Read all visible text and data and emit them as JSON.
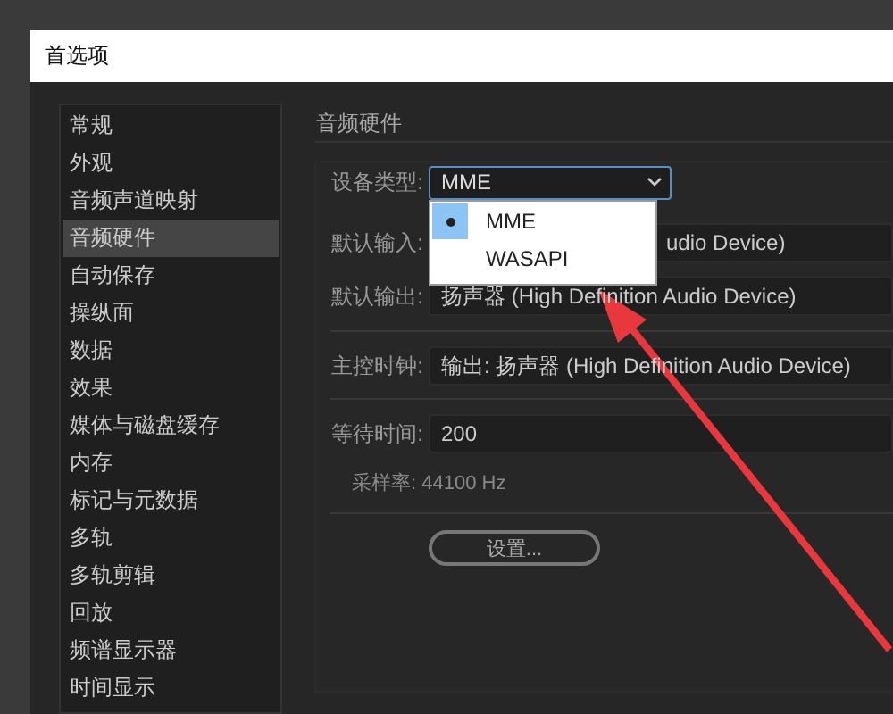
{
  "window": {
    "title": "首选项"
  },
  "sidebar": {
    "items": [
      {
        "label": "常规",
        "selected": false
      },
      {
        "label": "外观",
        "selected": false
      },
      {
        "label": "音频声道映射",
        "selected": false
      },
      {
        "label": "音频硬件",
        "selected": true
      },
      {
        "label": "自动保存",
        "selected": false
      },
      {
        "label": "操纵面",
        "selected": false
      },
      {
        "label": "数据",
        "selected": false
      },
      {
        "label": "效果",
        "selected": false
      },
      {
        "label": "媒体与磁盘缓存",
        "selected": false
      },
      {
        "label": "内存",
        "selected": false
      },
      {
        "label": "标记与元数据",
        "selected": false
      },
      {
        "label": "多轨",
        "selected": false
      },
      {
        "label": "多轨剪辑",
        "selected": false
      },
      {
        "label": "回放",
        "selected": false
      },
      {
        "label": "频谱显示器",
        "selected": false
      },
      {
        "label": "时间显示",
        "selected": false
      }
    ]
  },
  "section": {
    "title": "音频硬件",
    "device_type": {
      "label": "设备类型:",
      "value": "MME",
      "expanded": true,
      "options": [
        {
          "label": "MME",
          "selected": true
        },
        {
          "label": "WASAPI",
          "selected": false
        }
      ]
    },
    "default_input": {
      "label": "默认输入:",
      "value": "udio Device)"
    },
    "default_output": {
      "label": "默认输出:",
      "value": "扬声器 (High Definition Audio Device)"
    },
    "master_clock": {
      "label": "主控时钟:",
      "value": "输出: 扬声器 (High Definition Audio Device)"
    },
    "latency": {
      "label": "等待时间:",
      "value": "200"
    },
    "sample_rate": {
      "text": "采样率: 44100 Hz"
    },
    "settings_button": "设置..."
  }
}
